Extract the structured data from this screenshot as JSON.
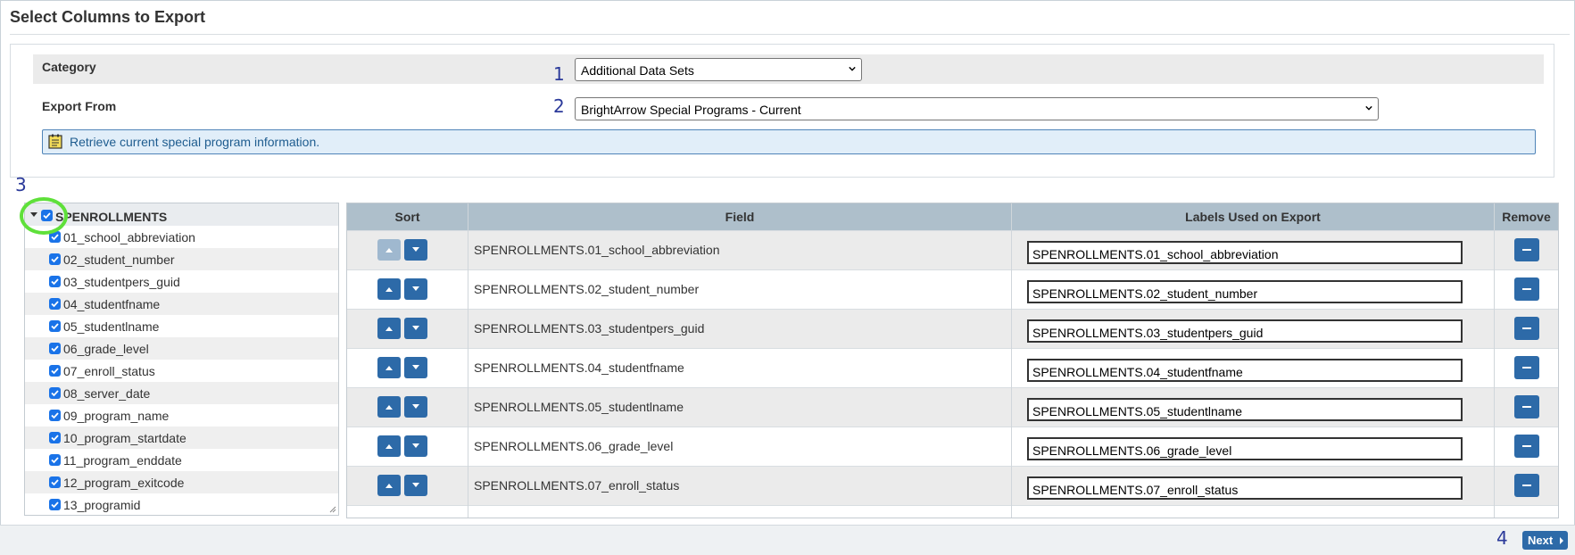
{
  "page": {
    "title": "Select Columns to Export"
  },
  "annotations": [
    "1",
    "2",
    "3",
    "4"
  ],
  "category": {
    "label": "Category",
    "value": "Additional Data Sets"
  },
  "export_from": {
    "label": "Export From",
    "value": "BrightArrow Special Programs - Current"
  },
  "info": {
    "text": "Retrieve current special program information."
  },
  "tree": {
    "root": "SPENROLLMENTS",
    "items": [
      "01_school_abbreviation",
      "02_student_number",
      "03_studentpers_guid",
      "04_studentfname",
      "05_studentlname",
      "06_grade_level",
      "07_enroll_status",
      "08_server_date",
      "09_program_name",
      "10_program_startdate",
      "11_program_enddate",
      "12_program_exitcode",
      "13_programid"
    ]
  },
  "table": {
    "headers": {
      "sort": "Sort",
      "field": "Field",
      "labels": "Labels Used on Export",
      "remove": "Remove"
    },
    "rows": [
      {
        "field": "SPENROLLMENTS.01_school_abbreviation",
        "label": "SPENROLLMENTS.01_school_abbreviation"
      },
      {
        "field": "SPENROLLMENTS.02_student_number",
        "label": "SPENROLLMENTS.02_student_number"
      },
      {
        "field": "SPENROLLMENTS.03_studentpers_guid",
        "label": "SPENROLLMENTS.03_studentpers_guid"
      },
      {
        "field": "SPENROLLMENTS.04_studentfname",
        "label": "SPENROLLMENTS.04_studentfname"
      },
      {
        "field": "SPENROLLMENTS.05_studentlname",
        "label": "SPENROLLMENTS.05_studentlname"
      },
      {
        "field": "SPENROLLMENTS.06_grade_level",
        "label": "SPENROLLMENTS.06_grade_level"
      },
      {
        "field": "SPENROLLMENTS.07_enroll_status",
        "label": "SPENROLLMENTS.07_enroll_status"
      }
    ]
  },
  "footer": {
    "next_label": "Next"
  },
  "colors": {
    "accent": "#2d6aa8",
    "header": "#aebfcb",
    "info_bg": "#e1eef9",
    "highlight": "#5fe03a"
  }
}
